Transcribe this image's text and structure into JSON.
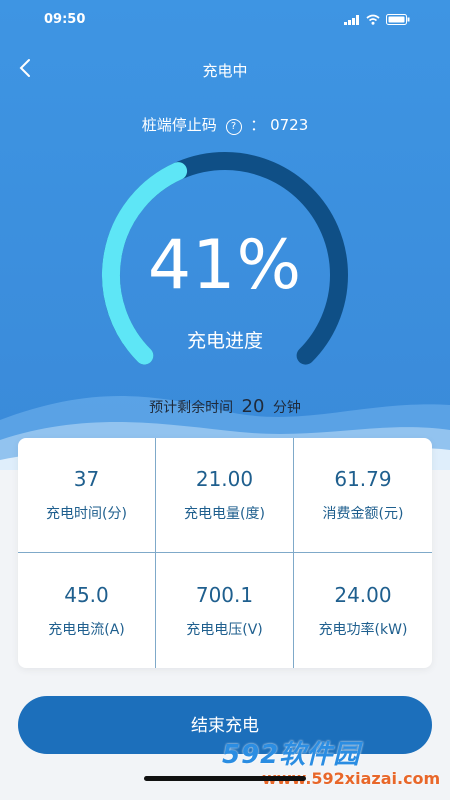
{
  "status_bar": {
    "time": "09:50"
  },
  "nav": {
    "title": "充电中"
  },
  "stop_code": {
    "label": "桩端停止码",
    "help": "?",
    "separator": "：",
    "value": "0723"
  },
  "progress": {
    "percent": 41,
    "percent_text": "41%",
    "label": "充电进度"
  },
  "remaining": {
    "prefix": "预计剩余时间",
    "minutes": "20",
    "unit": "分钟"
  },
  "stats": [
    {
      "value": "37",
      "label": "充电时间(分)"
    },
    {
      "value": "21.00",
      "label": "充电电量(度)"
    },
    {
      "value": "61.79",
      "label": "消费金额(元)"
    },
    {
      "value": "45.0",
      "label": "充电电流(A)"
    },
    {
      "value": "700.1",
      "label": "充电电压(V)"
    },
    {
      "value": "24.00",
      "label": "充电功率(kW)"
    }
  ],
  "end_button": {
    "label": "结束充电"
  },
  "watermark": {
    "top": "592软件园",
    "bottom": "www.592xiazai.com"
  },
  "colors": {
    "header": "#3e95e3",
    "progress_arc": "#5ee6f6",
    "track_arc": "#0f4f86",
    "button": "#1c6fbb",
    "stat_text": "#1f5f8e"
  }
}
